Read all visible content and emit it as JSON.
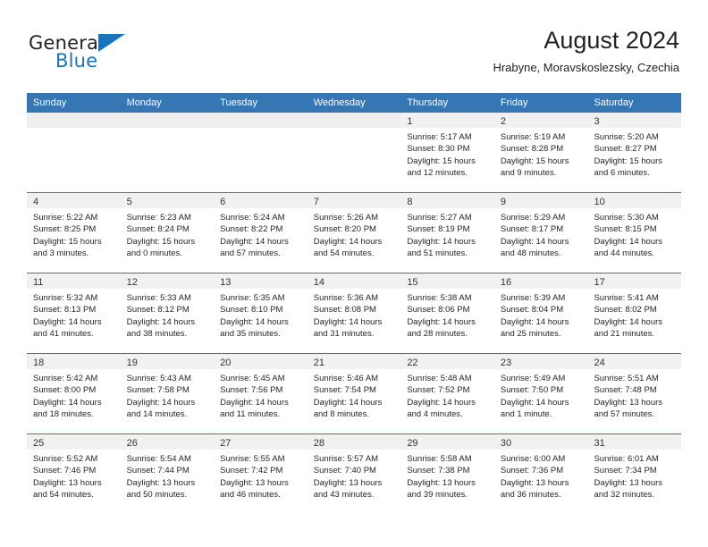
{
  "brand": {
    "name_top": "General",
    "name_bottom": "Blue",
    "accent_color": "#1a74bb",
    "triangle_icon": "brand-triangle-icon"
  },
  "header": {
    "title": "August 2024",
    "subtitle": "Hrabyne, Moravskoslezsky, Czechia"
  },
  "calendar": {
    "header_bg": "#3576b5",
    "header_text_color": "#ffffff",
    "daynum_bg": "#f1f1f1",
    "weekdays": [
      "Sunday",
      "Monday",
      "Tuesday",
      "Wednesday",
      "Thursday",
      "Friday",
      "Saturday"
    ],
    "weeks": [
      [
        {
          "day": "",
          "lines": []
        },
        {
          "day": "",
          "lines": []
        },
        {
          "day": "",
          "lines": []
        },
        {
          "day": "",
          "lines": []
        },
        {
          "day": "1",
          "lines": [
            "Sunrise: 5:17 AM",
            "Sunset: 8:30 PM",
            "Daylight: 15 hours",
            "and 12 minutes."
          ]
        },
        {
          "day": "2",
          "lines": [
            "Sunrise: 5:19 AM",
            "Sunset: 8:28 PM",
            "Daylight: 15 hours",
            "and 9 minutes."
          ]
        },
        {
          "day": "3",
          "lines": [
            "Sunrise: 5:20 AM",
            "Sunset: 8:27 PM",
            "Daylight: 15 hours",
            "and 6 minutes."
          ]
        }
      ],
      [
        {
          "day": "4",
          "lines": [
            "Sunrise: 5:22 AM",
            "Sunset: 8:25 PM",
            "Daylight: 15 hours",
            "and 3 minutes."
          ]
        },
        {
          "day": "5",
          "lines": [
            "Sunrise: 5:23 AM",
            "Sunset: 8:24 PM",
            "Daylight: 15 hours",
            "and 0 minutes."
          ]
        },
        {
          "day": "6",
          "lines": [
            "Sunrise: 5:24 AM",
            "Sunset: 8:22 PM",
            "Daylight: 14 hours",
            "and 57 minutes."
          ]
        },
        {
          "day": "7",
          "lines": [
            "Sunrise: 5:26 AM",
            "Sunset: 8:20 PM",
            "Daylight: 14 hours",
            "and 54 minutes."
          ]
        },
        {
          "day": "8",
          "lines": [
            "Sunrise: 5:27 AM",
            "Sunset: 8:19 PM",
            "Daylight: 14 hours",
            "and 51 minutes."
          ]
        },
        {
          "day": "9",
          "lines": [
            "Sunrise: 5:29 AM",
            "Sunset: 8:17 PM",
            "Daylight: 14 hours",
            "and 48 minutes."
          ]
        },
        {
          "day": "10",
          "lines": [
            "Sunrise: 5:30 AM",
            "Sunset: 8:15 PM",
            "Daylight: 14 hours",
            "and 44 minutes."
          ]
        }
      ],
      [
        {
          "day": "11",
          "lines": [
            "Sunrise: 5:32 AM",
            "Sunset: 8:13 PM",
            "Daylight: 14 hours",
            "and 41 minutes."
          ]
        },
        {
          "day": "12",
          "lines": [
            "Sunrise: 5:33 AM",
            "Sunset: 8:12 PM",
            "Daylight: 14 hours",
            "and 38 minutes."
          ]
        },
        {
          "day": "13",
          "lines": [
            "Sunrise: 5:35 AM",
            "Sunset: 8:10 PM",
            "Daylight: 14 hours",
            "and 35 minutes."
          ]
        },
        {
          "day": "14",
          "lines": [
            "Sunrise: 5:36 AM",
            "Sunset: 8:08 PM",
            "Daylight: 14 hours",
            "and 31 minutes."
          ]
        },
        {
          "day": "15",
          "lines": [
            "Sunrise: 5:38 AM",
            "Sunset: 8:06 PM",
            "Daylight: 14 hours",
            "and 28 minutes."
          ]
        },
        {
          "day": "16",
          "lines": [
            "Sunrise: 5:39 AM",
            "Sunset: 8:04 PM",
            "Daylight: 14 hours",
            "and 25 minutes."
          ]
        },
        {
          "day": "17",
          "lines": [
            "Sunrise: 5:41 AM",
            "Sunset: 8:02 PM",
            "Daylight: 14 hours",
            "and 21 minutes."
          ]
        }
      ],
      [
        {
          "day": "18",
          "lines": [
            "Sunrise: 5:42 AM",
            "Sunset: 8:00 PM",
            "Daylight: 14 hours",
            "and 18 minutes."
          ]
        },
        {
          "day": "19",
          "lines": [
            "Sunrise: 5:43 AM",
            "Sunset: 7:58 PM",
            "Daylight: 14 hours",
            "and 14 minutes."
          ]
        },
        {
          "day": "20",
          "lines": [
            "Sunrise: 5:45 AM",
            "Sunset: 7:56 PM",
            "Daylight: 14 hours",
            "and 11 minutes."
          ]
        },
        {
          "day": "21",
          "lines": [
            "Sunrise: 5:46 AM",
            "Sunset: 7:54 PM",
            "Daylight: 14 hours",
            "and 8 minutes."
          ]
        },
        {
          "day": "22",
          "lines": [
            "Sunrise: 5:48 AM",
            "Sunset: 7:52 PM",
            "Daylight: 14 hours",
            "and 4 minutes."
          ]
        },
        {
          "day": "23",
          "lines": [
            "Sunrise: 5:49 AM",
            "Sunset: 7:50 PM",
            "Daylight: 14 hours",
            "and 1 minute."
          ]
        },
        {
          "day": "24",
          "lines": [
            "Sunrise: 5:51 AM",
            "Sunset: 7:48 PM",
            "Daylight: 13 hours",
            "and 57 minutes."
          ]
        }
      ],
      [
        {
          "day": "25",
          "lines": [
            "Sunrise: 5:52 AM",
            "Sunset: 7:46 PM",
            "Daylight: 13 hours",
            "and 54 minutes."
          ]
        },
        {
          "day": "26",
          "lines": [
            "Sunrise: 5:54 AM",
            "Sunset: 7:44 PM",
            "Daylight: 13 hours",
            "and 50 minutes."
          ]
        },
        {
          "day": "27",
          "lines": [
            "Sunrise: 5:55 AM",
            "Sunset: 7:42 PM",
            "Daylight: 13 hours",
            "and 46 minutes."
          ]
        },
        {
          "day": "28",
          "lines": [
            "Sunrise: 5:57 AM",
            "Sunset: 7:40 PM",
            "Daylight: 13 hours",
            "and 43 minutes."
          ]
        },
        {
          "day": "29",
          "lines": [
            "Sunrise: 5:58 AM",
            "Sunset: 7:38 PM",
            "Daylight: 13 hours",
            "and 39 minutes."
          ]
        },
        {
          "day": "30",
          "lines": [
            "Sunrise: 6:00 AM",
            "Sunset: 7:36 PM",
            "Daylight: 13 hours",
            "and 36 minutes."
          ]
        },
        {
          "day": "31",
          "lines": [
            "Sunrise: 6:01 AM",
            "Sunset: 7:34 PM",
            "Daylight: 13 hours",
            "and 32 minutes."
          ]
        }
      ]
    ]
  }
}
